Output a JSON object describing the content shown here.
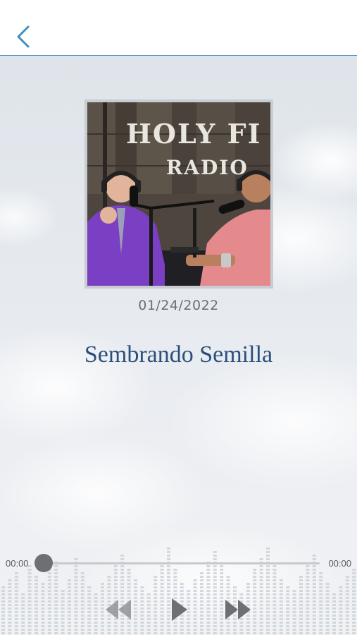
{
  "header": {
    "back_icon": "chevron-left-icon"
  },
  "episode": {
    "date": "01/24/2022",
    "title": "Sembrando Semilla",
    "artwork_sign_line1": "HOLY FI",
    "artwork_sign_line2": "RADIO"
  },
  "player": {
    "current_time": "00:00",
    "total_time": "00:00",
    "progress": 0,
    "controls": {
      "rewind_icon": "rewind-icon",
      "play_icon": "play-icon",
      "forward_icon": "fast-forward-icon"
    }
  },
  "colors": {
    "accent": "#3f8fbf",
    "title": "#2b4f7d",
    "control": "#6d6f72"
  }
}
